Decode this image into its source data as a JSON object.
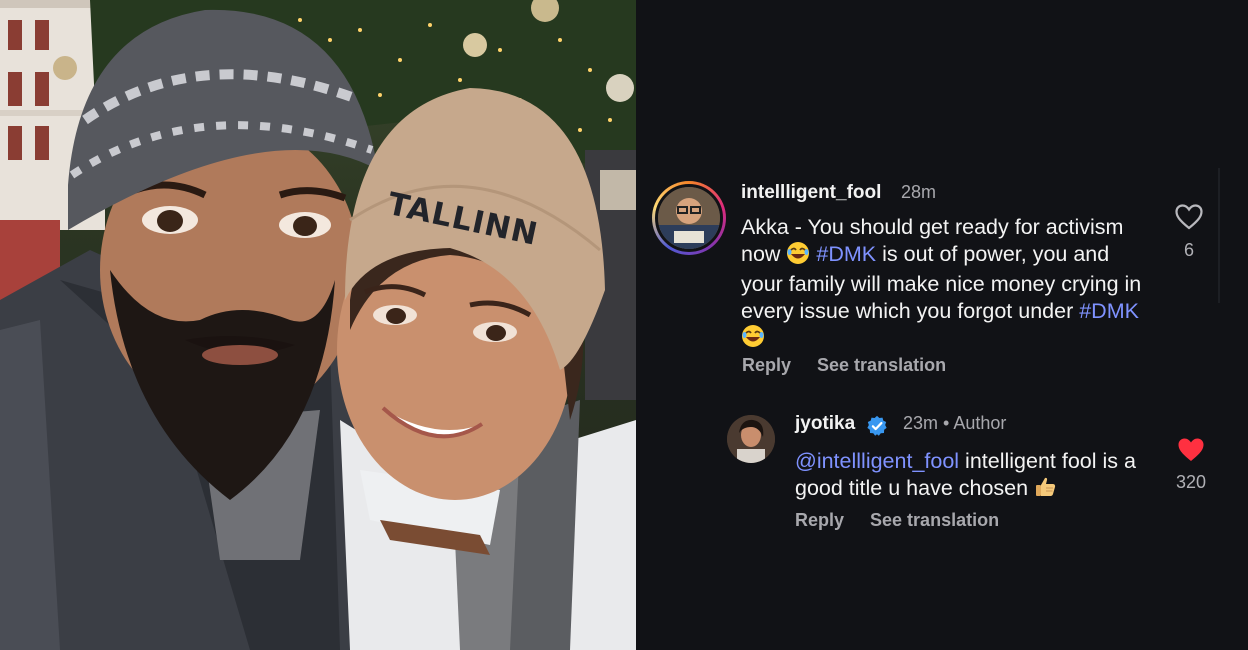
{
  "photo": {
    "hat_text": "TALLINN"
  },
  "comments": [
    {
      "username": "intellligent_fool",
      "time": "28m",
      "text_before": "Akka - You should get ready for activism now ",
      "hashtag_1": "#DMK",
      "text_middle": " is out of power, you and your family will make nice money crying in every issue which you forgot under ",
      "hashtag_2": "#DMK",
      "reply_label": "Reply",
      "translate_label": "See translation",
      "like_count": "6",
      "liked": false
    }
  ],
  "reply": {
    "username": "jyotika",
    "time": "23m",
    "separator": "•",
    "author_label": "Author",
    "mention": "@intellligent_fool",
    "text": " intelligent fool is a good title u have chosen ",
    "reply_label": "Reply",
    "translate_label": "See translation",
    "like_count": "320",
    "liked": true
  },
  "colors": {
    "background": "#111216",
    "hashtag": "#7f92ff",
    "liked_heart": "#ff3040",
    "verified": "#3897f0"
  },
  "icons": [
    "heart-outline-icon",
    "heart-filled-icon",
    "verified-badge-icon",
    "laughing-emoji-icon",
    "thumbs-up-emoji-icon"
  ]
}
